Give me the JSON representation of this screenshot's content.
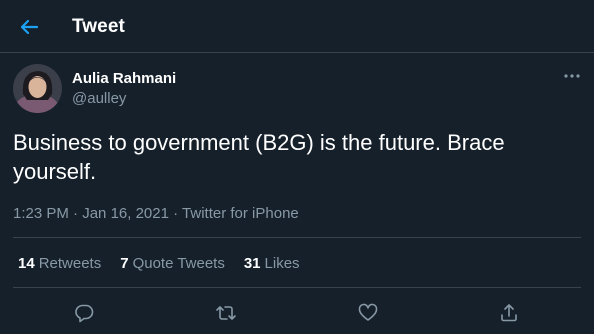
{
  "header": {
    "title": "Tweet",
    "back_icon": "arrow-left-icon"
  },
  "colors": {
    "background": "#15202b",
    "accent": "#1da1f2",
    "secondary_text": "#8899a6",
    "divider": "#38444d"
  },
  "tweet": {
    "author_name": "Aulia Rahmani",
    "author_handle": "@aulley",
    "text": "Business to government (B2G) is the future. Brace yourself.",
    "time": "1:23 PM",
    "date": "Jan 16, 2021",
    "source": "Twitter for iPhone",
    "separator": "·"
  },
  "stats": {
    "retweets": {
      "count": "14",
      "label": "Retweets"
    },
    "quote_tweets": {
      "count": "7",
      "label": "Quote Tweets"
    },
    "likes": {
      "count": "31",
      "label": "Likes"
    }
  },
  "actions": [
    "reply-icon",
    "retweet-icon",
    "like-icon",
    "share-icon"
  ]
}
